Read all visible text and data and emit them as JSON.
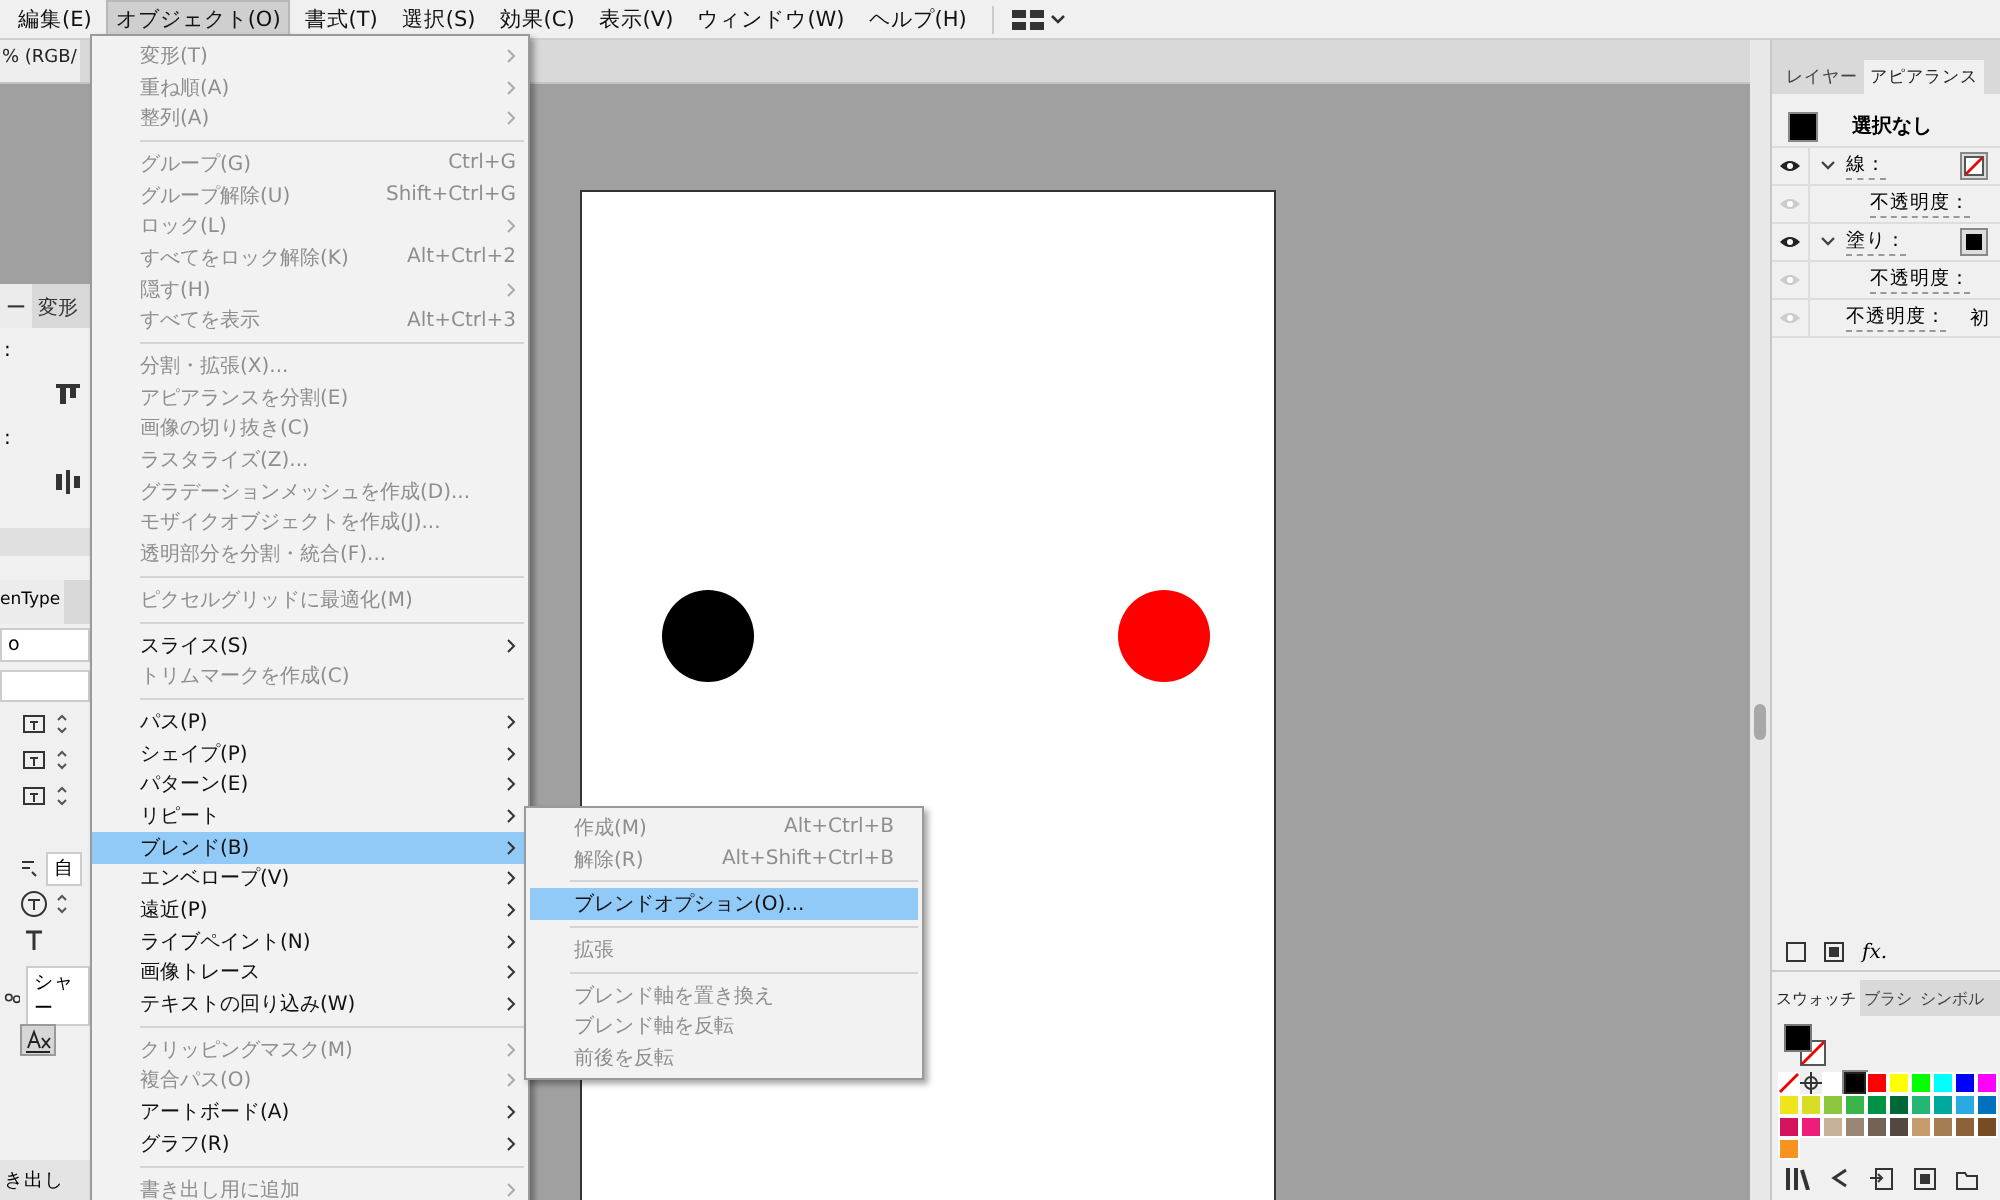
{
  "menubar": {
    "items": [
      {
        "label": "編集(E)",
        "selected": false
      },
      {
        "label": "オブジェクト(O)",
        "selected": true
      },
      {
        "label": "書式(T)",
        "selected": false
      },
      {
        "label": "選択(S)",
        "selected": false
      },
      {
        "label": "効果(C)",
        "selected": false
      },
      {
        "label": "表示(V)",
        "selected": false
      },
      {
        "label": "ウィンドウ(W)",
        "selected": false
      },
      {
        "label": "ヘルプ(H)",
        "selected": false
      }
    ]
  },
  "document_tab": {
    "label": "% (RGB/"
  },
  "left_panel": {
    "tabs": [
      {
        "label": "ー",
        "selected": true
      },
      {
        "label": "変形",
        "selected": false
      }
    ],
    "labels": [
      ":",
      ":"
    ],
    "type_tab": "enType",
    "font_field": "o",
    "auto_field": "自",
    "language_field": "シャー",
    "export_label": "き出し"
  },
  "object_menu": {
    "groups": [
      [
        {
          "label": "変形(T)",
          "disabled": true,
          "submenu": true,
          "selected": false
        },
        {
          "label": "重ね順(A)",
          "disabled": true,
          "submenu": true,
          "selected": false
        },
        {
          "label": "整列(A)",
          "disabled": true,
          "submenu": true,
          "selected": false
        }
      ],
      [
        {
          "label": "グループ(G)",
          "shortcut": "Ctrl+G",
          "disabled": true,
          "submenu": false,
          "selected": false
        },
        {
          "label": "グループ解除(U)",
          "shortcut": "Shift+Ctrl+G",
          "disabled": true,
          "submenu": false,
          "selected": false
        },
        {
          "label": "ロック(L)",
          "disabled": true,
          "submenu": true,
          "selected": false
        },
        {
          "label": "すべてをロック解除(K)",
          "shortcut": "Alt+Ctrl+2",
          "disabled": true,
          "submenu": false,
          "selected": false
        },
        {
          "label": "隠す(H)",
          "disabled": true,
          "submenu": true,
          "selected": false
        },
        {
          "label": "すべてを表示",
          "shortcut": "Alt+Ctrl+3",
          "disabled": true,
          "submenu": false,
          "selected": false
        }
      ],
      [
        {
          "label": "分割・拡張(X)...",
          "disabled": true,
          "submenu": false,
          "selected": false
        },
        {
          "label": "アピアランスを分割(E)",
          "disabled": true,
          "submenu": false,
          "selected": false
        },
        {
          "label": "画像の切り抜き(C)",
          "disabled": true,
          "submenu": false,
          "selected": false
        },
        {
          "label": "ラスタライズ(Z)...",
          "disabled": true,
          "submenu": false,
          "selected": false
        },
        {
          "label": "グラデーションメッシュを作成(D)...",
          "disabled": true,
          "submenu": false,
          "selected": false
        },
        {
          "label": "モザイクオブジェクトを作成(J)...",
          "disabled": true,
          "submenu": false,
          "selected": false
        },
        {
          "label": "透明部分を分割・統合(F)...",
          "disabled": true,
          "submenu": false,
          "selected": false
        }
      ],
      [
        {
          "label": "ピクセルグリッドに最適化(M)",
          "disabled": true,
          "submenu": false,
          "selected": false
        }
      ],
      [
        {
          "label": "スライス(S)",
          "disabled": false,
          "submenu": true,
          "selected": false
        },
        {
          "label": "トリムマークを作成(C)",
          "disabled": true,
          "submenu": false,
          "selected": false
        }
      ],
      [
        {
          "label": "パス(P)",
          "disabled": false,
          "submenu": true,
          "selected": false
        },
        {
          "label": "シェイプ(P)",
          "disabled": false,
          "submenu": true,
          "selected": false
        },
        {
          "label": "パターン(E)",
          "disabled": false,
          "submenu": true,
          "selected": false
        },
        {
          "label": "リピート",
          "disabled": false,
          "submenu": true,
          "selected": false
        },
        {
          "label": "ブレンド(B)",
          "disabled": false,
          "submenu": true,
          "selected": true
        },
        {
          "label": "エンベロープ(V)",
          "disabled": false,
          "submenu": true,
          "selected": false
        },
        {
          "label": "遠近(P)",
          "disabled": false,
          "submenu": true,
          "selected": false
        },
        {
          "label": "ライブペイント(N)",
          "disabled": false,
          "submenu": true,
          "selected": false
        },
        {
          "label": "画像トレース",
          "disabled": false,
          "submenu": true,
          "selected": false
        },
        {
          "label": "テキストの回り込み(W)",
          "disabled": false,
          "submenu": true,
          "selected": false
        }
      ],
      [
        {
          "label": "クリッピングマスク(M)",
          "disabled": true,
          "submenu": true,
          "selected": false
        },
        {
          "label": "複合パス(O)",
          "disabled": true,
          "submenu": true,
          "selected": false
        },
        {
          "label": "アートボード(A)",
          "disabled": false,
          "submenu": true,
          "selected": false
        },
        {
          "label": "グラフ(R)",
          "disabled": false,
          "submenu": true,
          "selected": false
        }
      ],
      [
        {
          "label": "書き出し用に追加",
          "disabled": true,
          "submenu": true,
          "selected": false
        }
      ]
    ]
  },
  "blend_submenu": {
    "groups": [
      [
        {
          "label": "作成(M)",
          "shortcut": "Alt+Ctrl+B",
          "disabled": true,
          "submenu": false,
          "selected": false
        },
        {
          "label": "解除(R)",
          "shortcut": "Alt+Shift+Ctrl+B",
          "disabled": true,
          "submenu": false,
          "selected": false
        }
      ],
      [
        {
          "label": "ブレンドオプション(O)...",
          "disabled": false,
          "submenu": false,
          "selected": true
        }
      ],
      [
        {
          "label": "拡張",
          "disabled": true,
          "submenu": false,
          "selected": false
        }
      ],
      [
        {
          "label": "ブレンド軸を置き換え",
          "disabled": true,
          "submenu": false,
          "selected": false
        },
        {
          "label": "ブレンド軸を反転",
          "disabled": true,
          "submenu": false,
          "selected": false
        },
        {
          "label": "前後を反転",
          "disabled": true,
          "submenu": false,
          "selected": false
        }
      ]
    ]
  },
  "artboard": {
    "shapes": [
      {
        "kind": "circle",
        "color": "#000000"
      },
      {
        "kind": "circle",
        "color": "#ff0000"
      }
    ]
  },
  "appearance_panel": {
    "tabs": [
      {
        "label": "レイヤー",
        "selected": false
      },
      {
        "label": "アピアランス",
        "selected": true
      }
    ],
    "header": {
      "label": "選択なし"
    },
    "rows": [
      {
        "kind": "stroke",
        "label": "線：",
        "visible": true,
        "expanded": true,
        "children": [
          {
            "kind": "opacity",
            "label": "不透明度：",
            "visible": false
          }
        ]
      },
      {
        "kind": "fill",
        "label": "塗り：",
        "color": "#000000",
        "visible": true,
        "expanded": true,
        "children": [
          {
            "kind": "opacity",
            "label": "不透明度：",
            "visible": false
          }
        ]
      },
      {
        "kind": "opacity",
        "label": "不透明度：",
        "value": "初",
        "visible": false
      }
    ],
    "fx_button": "fx."
  },
  "swatch_panel": {
    "tabs": [
      {
        "label": "スウォッチ",
        "selected": true
      },
      {
        "label": "ブラシ",
        "selected": false
      },
      {
        "label": "シンボル",
        "selected": false
      }
    ],
    "swatches": [
      {
        "kind": "none",
        "selected": false
      },
      {
        "kind": "registration",
        "selected": false
      },
      {
        "kind": "color",
        "color": "#ffffff",
        "selected": false
      },
      {
        "kind": "color",
        "color": "#000000",
        "selected": true
      },
      {
        "kind": "color",
        "color": "#ff0000",
        "selected": false
      },
      {
        "kind": "color",
        "color": "#ffff00",
        "selected": false
      },
      {
        "kind": "color",
        "color": "#00ff00",
        "selected": false
      },
      {
        "kind": "color",
        "color": "#00ffff",
        "selected": false
      },
      {
        "kind": "color",
        "color": "#0000ff",
        "selected": false
      },
      {
        "kind": "color",
        "color": "#ff00ff",
        "selected": false
      },
      {
        "kind": "color",
        "color": "#f0e51a",
        "selected": false
      },
      {
        "kind": "color",
        "color": "#d8de24",
        "selected": false
      },
      {
        "kind": "color",
        "color": "#8cc63f",
        "selected": false
      },
      {
        "kind": "color",
        "color": "#39b54a",
        "selected": false
      },
      {
        "kind": "color",
        "color": "#009245",
        "selected": false
      },
      {
        "kind": "color",
        "color": "#006837",
        "selected": false
      },
      {
        "kind": "color",
        "color": "#22b573",
        "selected": false
      },
      {
        "kind": "color",
        "color": "#00a99d",
        "selected": false
      },
      {
        "kind": "color",
        "color": "#29abe2",
        "selected": false
      },
      {
        "kind": "color",
        "color": "#0071bc",
        "selected": false
      },
      {
        "kind": "color",
        "color": "#d4145a",
        "selected": false
      },
      {
        "kind": "color",
        "color": "#ed1e79",
        "selected": false
      },
      {
        "kind": "color",
        "color": "#c7b299",
        "selected": false
      },
      {
        "kind": "color",
        "color": "#998675",
        "selected": false
      },
      {
        "kind": "color",
        "color": "#736357",
        "selected": false
      },
      {
        "kind": "color",
        "color": "#534741",
        "selected": false
      },
      {
        "kind": "color",
        "color": "#c69c6d",
        "selected": false
      },
      {
        "kind": "color",
        "color": "#a67c52",
        "selected": false
      },
      {
        "kind": "color",
        "color": "#8c6239",
        "selected": false
      },
      {
        "kind": "color",
        "color": "#754c24",
        "selected": false
      },
      {
        "kind": "color",
        "color": "#f7931e",
        "selected": false
      }
    ]
  }
}
